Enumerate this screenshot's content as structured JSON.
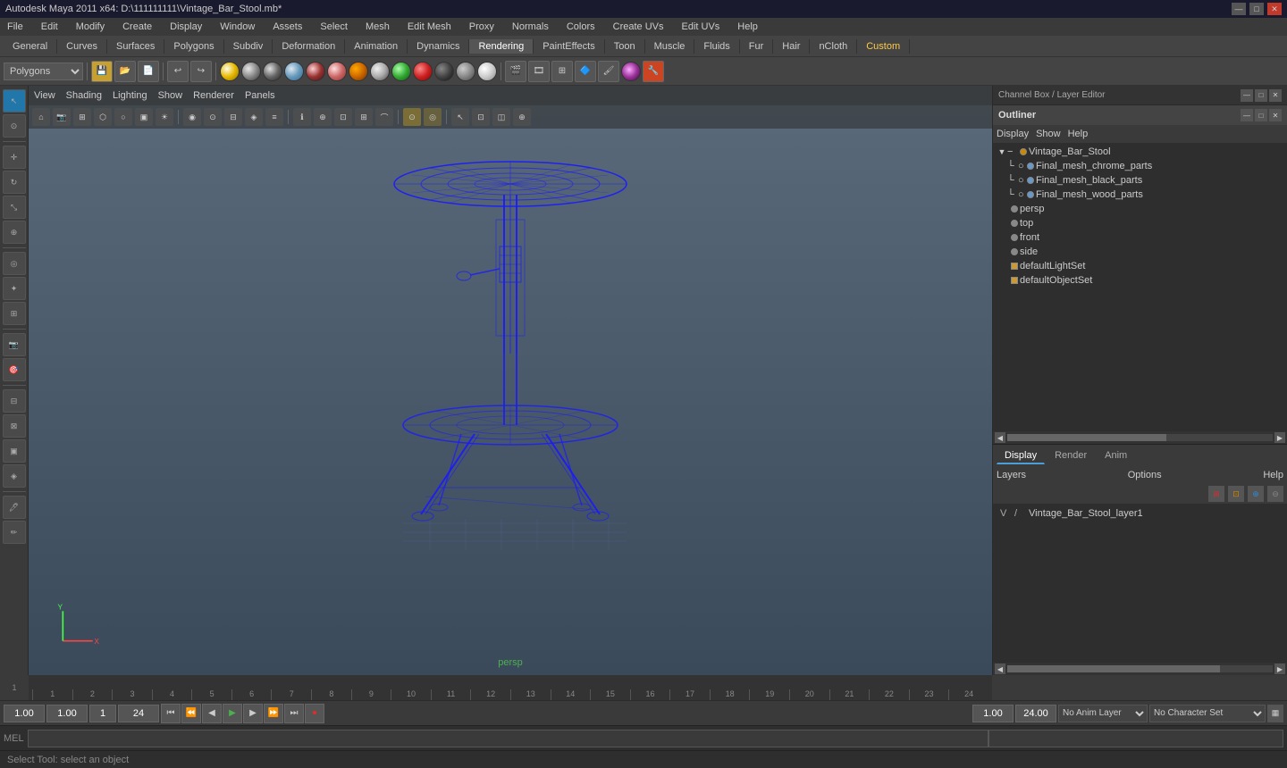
{
  "window": {
    "title": "Autodesk Maya 2011 x64: D:\\111111111\\Vintage_Bar_Stool.mb*",
    "controls": [
      "—",
      "□",
      "✕"
    ]
  },
  "menubar": {
    "items": [
      "File",
      "Edit",
      "Modify",
      "Create",
      "Display",
      "Window",
      "Assets",
      "Select",
      "Mesh",
      "Edit Mesh",
      "Proxy",
      "Normals",
      "Colors",
      "Create UVs",
      "Edit UVs",
      "Help"
    ]
  },
  "shelf_tabs": {
    "items": [
      "General",
      "Curves",
      "Surfaces",
      "Polygons",
      "Subdiv",
      "Deformation",
      "Animation",
      "Dynamics",
      "Rendering",
      "PaintEffects",
      "Toon",
      "Muscle",
      "Fluids",
      "Fur",
      "Hair",
      "nCloth",
      "Custom"
    ],
    "active": "Rendering"
  },
  "viewport": {
    "menus": [
      "View",
      "Shading",
      "Lighting",
      "Show",
      "Renderer",
      "Panels"
    ],
    "label": "persp",
    "mode": "Wireframe"
  },
  "outliner": {
    "title": "Outliner",
    "menus": [
      "Display",
      "Show",
      "Help"
    ],
    "items": [
      {
        "name": "Vintage_Bar_Stool",
        "depth": 0,
        "expanded": true,
        "type": "group"
      },
      {
        "name": "Final_mesh_chrome_parts",
        "depth": 1,
        "expanded": false,
        "type": "mesh"
      },
      {
        "name": "Final_mesh_black_parts",
        "depth": 1,
        "expanded": false,
        "type": "mesh"
      },
      {
        "name": "Final_mesh_wood_parts",
        "depth": 1,
        "expanded": false,
        "type": "mesh"
      },
      {
        "name": "persp",
        "depth": 0,
        "expanded": false,
        "type": "camera"
      },
      {
        "name": "top",
        "depth": 0,
        "expanded": false,
        "type": "camera"
      },
      {
        "name": "front",
        "depth": 0,
        "expanded": false,
        "type": "camera"
      },
      {
        "name": "side",
        "depth": 0,
        "expanded": false,
        "type": "camera"
      },
      {
        "name": "defaultLightSet",
        "depth": 0,
        "expanded": false,
        "type": "set"
      },
      {
        "name": "defaultObjectSet",
        "depth": 0,
        "expanded": false,
        "type": "set"
      }
    ]
  },
  "channel_box": {
    "title": "Channel Box / Layer Editor"
  },
  "layer_editor": {
    "tabs": [
      "Display",
      "Render",
      "Anim"
    ],
    "active_tab": "Display",
    "menus": [
      "Layers",
      "Options",
      "Help"
    ],
    "layers": [
      {
        "v": "V",
        "name": "Vintage_Bar_Stool_layer1"
      }
    ]
  },
  "timeline": {
    "start": 1,
    "end": 24,
    "marks": [
      "1",
      "2",
      "3",
      "4",
      "5",
      "6",
      "7",
      "8",
      "9",
      "10",
      "11",
      "12",
      "13",
      "14",
      "15",
      "16",
      "17",
      "18",
      "19",
      "20",
      "21",
      "22",
      "23",
      "24"
    ],
    "current": "1"
  },
  "status_bar": {
    "current_frame": "1.00",
    "frame_2": "1.00",
    "frame_3": "1",
    "end_frame": "24",
    "range_start": "1.00",
    "range_end": "24.00",
    "anim_layer": "No Anim Layer",
    "char_set": "No Character Set",
    "playback_btns": [
      "⏮",
      "⏪",
      "◀",
      "▶",
      "⏩",
      "⏭",
      "⏺"
    ]
  },
  "command_line": {
    "label": "MEL",
    "placeholder": ""
  },
  "help_line": {
    "text": "Select Tool: select an object"
  },
  "icons": {
    "arrow": "▶",
    "select": "↖",
    "lasso": "⊙",
    "move": "✛",
    "rotate": "↻",
    "scale": "⤡",
    "expand": "▼",
    "collapse": "▶",
    "minimize": "—",
    "maximize": "□",
    "close": "✕",
    "scroll_left": "◀",
    "scroll_right": "▶",
    "scroll_up": "▲",
    "scroll_down": "▼"
  }
}
